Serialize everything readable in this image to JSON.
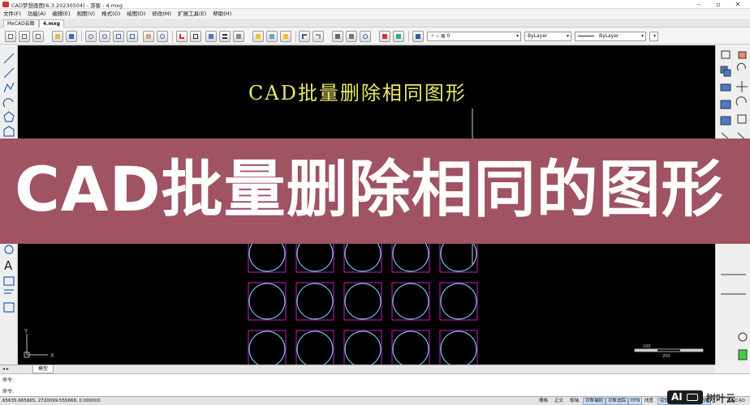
{
  "window": {
    "title": "CAD梦想画图(6.3.20230504) - 游客 - 4.mxg"
  },
  "menu": [
    "文件(F)",
    "功能(A)",
    "编辑(E)",
    "视图(V)",
    "格式(O)",
    "绘图(D)",
    "修改(M)",
    "扩展工具(E)",
    "帮助(H)"
  ],
  "doc_tabs": [
    "MxCAD云图",
    "4.mxg"
  ],
  "toolbar": {
    "layer_value": "0",
    "color_value": "ByLayer",
    "linetype_value": "ByLayer"
  },
  "drawing": {
    "annotation": "CAD批量删除相同图形",
    "colors": {
      "rect": "#c51fc5",
      "circle": "#7fe0ff",
      "text": "#e8e86a",
      "background": "#000000"
    },
    "grid": {
      "rows": 5,
      "cols": 5
    },
    "ucs": {
      "y": "Y",
      "x": "X"
    },
    "scale": {
      "left": "100",
      "right": "200"
    }
  },
  "banner": {
    "text": "CAD批量删除相同的图形",
    "color": "#9f5363"
  },
  "layout_tab": "模型",
  "command": {
    "line1": "命令:",
    "line2": "命令:"
  },
  "status": {
    "coords": "65635.665665, 2720099.555668, 0.000000",
    "buttons": [
      "栅格",
      "正交",
      "极轴",
      "对象捕捉",
      "对象追踪",
      "DYN",
      "线宽",
      "提交软件问题或增加新功能",
      "MxCAD"
    ]
  },
  "watermark": {
    "badge": "AI",
    "text": "树叶云"
  }
}
